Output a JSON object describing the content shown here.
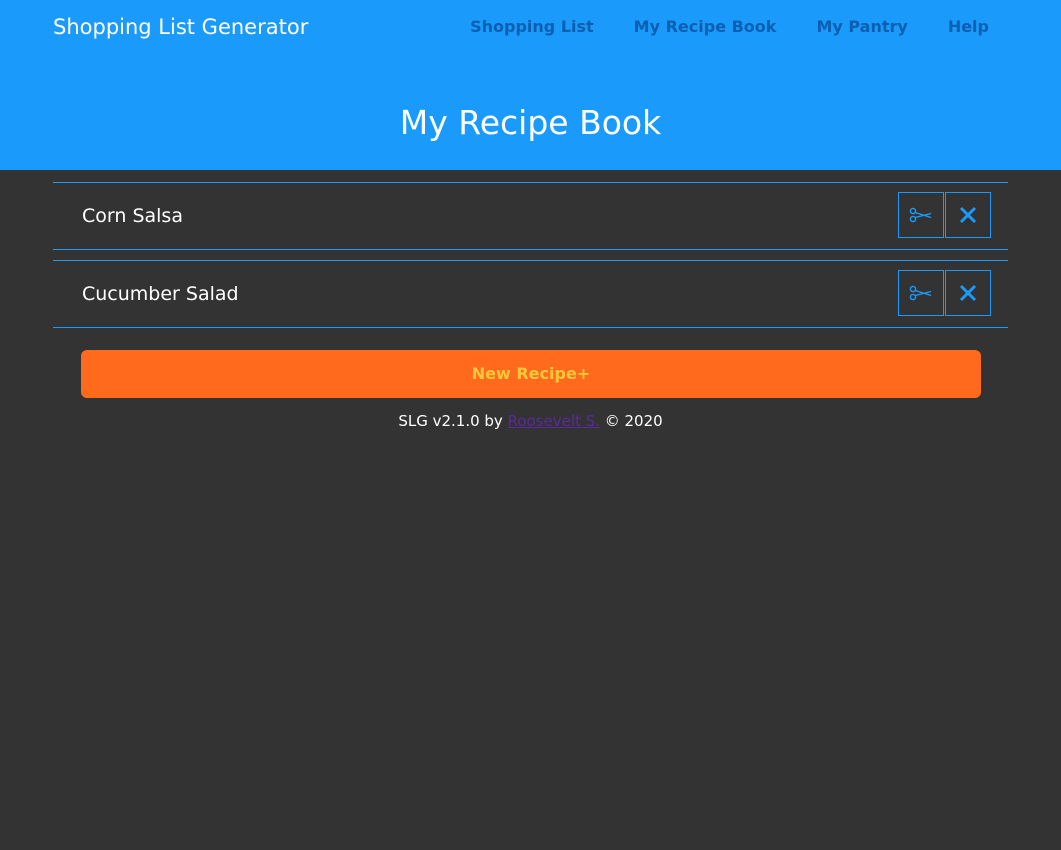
{
  "header": {
    "brand": "Shopping List Generator",
    "nav": [
      {
        "label": "Shopping List"
      },
      {
        "label": "My Recipe Book"
      },
      {
        "label": "My Pantry"
      },
      {
        "label": "Help"
      }
    ],
    "page_title": "My Recipe Book"
  },
  "recipes": [
    {
      "name": "Corn Salsa",
      "edit_icon": "scissors-icon",
      "delete_icon": "close-icon"
    },
    {
      "name": "Cucumber Salad",
      "edit_icon": "scissors-icon",
      "delete_icon": "close-icon"
    }
  ],
  "new_recipe_label": "New Recipe+",
  "footer": {
    "prefix": "SLG v2.1.0 by",
    "author": "Roosevelt S.",
    "suffix": "© 2020"
  },
  "colors": {
    "header_bg": "#1a9bfc",
    "page_bg": "#333333",
    "nav_link": "#0a5fb0",
    "accent_orange": "#ff6a1c",
    "button_text": "#ffc83a",
    "author_link": "#5a2a9c"
  }
}
